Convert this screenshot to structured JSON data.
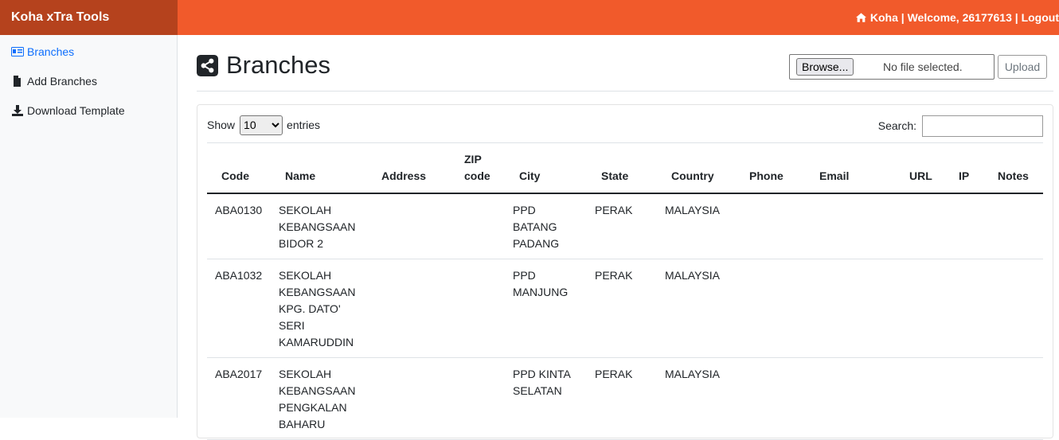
{
  "header": {
    "brand": "Koha xTra Tools",
    "home_link": "Koha",
    "welcome": "Welcome, 26177613",
    "logout": "Logout",
    "separator": "|",
    "bar_color": "#f15a2b",
    "brand_color": "#b5421d"
  },
  "sidebar": {
    "items": [
      {
        "label": "Branches",
        "icon": "id-card-icon",
        "active": true
      },
      {
        "label": "Add Branches",
        "icon": "file-icon",
        "active": false
      },
      {
        "label": "Download Template",
        "icon": "download-icon",
        "active": false
      }
    ]
  },
  "page": {
    "title": "Branches",
    "title_icon": "share-icon"
  },
  "upload": {
    "browse_label": "Browse...",
    "file_status": "No file selected.",
    "upload_label": "Upload"
  },
  "table_controls": {
    "show_label": "Show",
    "entries_value": "10",
    "entries_label": "entries",
    "search_label": "Search:",
    "search_value": ""
  },
  "table": {
    "columns": [
      "Code",
      "Name",
      "Address",
      "ZIP code",
      "City",
      "State",
      "Country",
      "Phone",
      "Email",
      "URL",
      "IP",
      "Notes"
    ],
    "rows": [
      {
        "code": "ABA0130",
        "name": "SEKOLAH KEBANGSAAN BIDOR 2",
        "address": "",
        "zip": "",
        "city": "PPD BATANG PADANG",
        "state": "PERAK",
        "country": "MALAYSIA",
        "phone": "",
        "email": "",
        "url": "",
        "ip": "",
        "notes": ""
      },
      {
        "code": "ABA1032",
        "name": "SEKOLAH KEBANGSAAN KPG. DATO' SERI KAMARUDDIN",
        "address": "",
        "zip": "",
        "city": "PPD MANJUNG",
        "state": "PERAK",
        "country": "MALAYSIA",
        "phone": "",
        "email": "",
        "url": "",
        "ip": "",
        "notes": ""
      },
      {
        "code": "ABA2017",
        "name": "SEKOLAH KEBANGSAAN PENGKALAN BAHARU",
        "address": "",
        "zip": "",
        "city": "PPD KINTA SELATAN",
        "state": "PERAK",
        "country": "MALAYSIA",
        "phone": "",
        "email": "",
        "url": "",
        "ip": "",
        "notes": ""
      }
    ]
  }
}
